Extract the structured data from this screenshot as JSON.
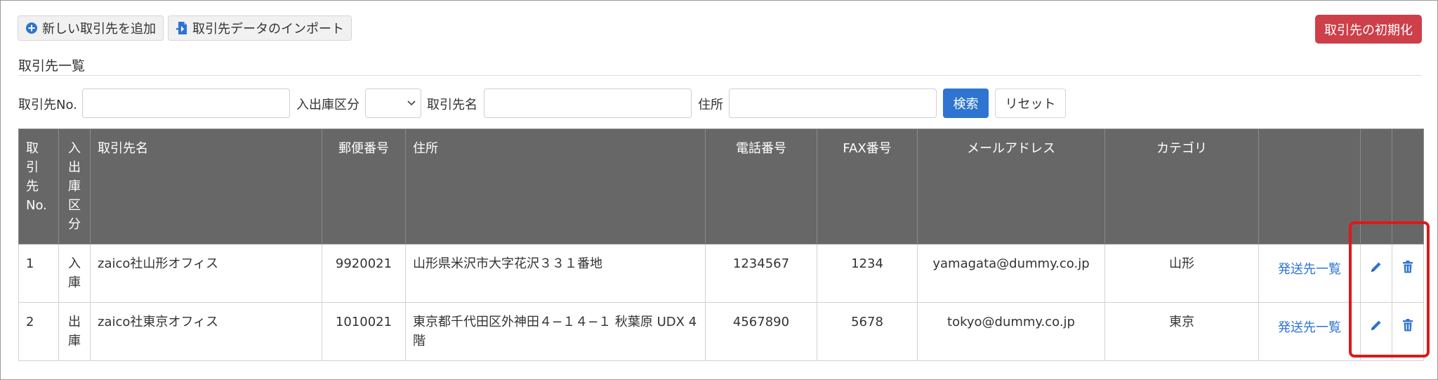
{
  "toolbar": {
    "add_label": "新しい取引先を追加",
    "import_label": "取引先データのインポート",
    "reset_all_label": "取引先の初期化"
  },
  "section": {
    "title": "取引先一覧"
  },
  "filters": {
    "no_label": "取引先No.",
    "no_value": "",
    "type_label": "入出庫区分",
    "type_value": "",
    "name_label": "取引先名",
    "name_value": "",
    "address_label": "住所",
    "address_value": "",
    "search_label": "検索",
    "reset_label": "リセット"
  },
  "table": {
    "headers": {
      "no": "取\n引\n先\nNo.",
      "type": "入\n出\n庫\n区\n分",
      "name": "取引先名",
      "postal": "郵便番号",
      "address": "住所",
      "phone": "電話番号",
      "fax": "FAX番号",
      "email": "メールアドレス",
      "category": "カテゴリ"
    },
    "rows": [
      {
        "no": "1",
        "type": "入\n庫",
        "name": "zaico社山形オフィス",
        "postal": "9920021",
        "address": "山形県米沢市大字花沢３３１番地",
        "phone": "1234567",
        "fax": "1234",
        "email": "yamagata@dummy.co.jp",
        "category": "山形",
        "link": "発送先一覧"
      },
      {
        "no": "2",
        "type": "出\n庫",
        "name": "zaico社東京オフィス",
        "postal": "1010021",
        "address": "東京都千代田区外神田４−１４−１ 秋葉原 UDX 4階",
        "phone": "4567890",
        "fax": "5678",
        "email": "tokyo@dummy.co.jp",
        "category": "東京",
        "link": "発送先一覧"
      }
    ]
  },
  "colors": {
    "primary": "#2f74d0",
    "danger": "#cd3f49",
    "header_bg": "#676767",
    "highlight": "#e01818"
  },
  "icons": {
    "add": "plus-circle-icon",
    "import": "file-import-icon",
    "edit": "pencil-icon",
    "delete": "trash-icon",
    "select": "chevron-down-icon"
  }
}
